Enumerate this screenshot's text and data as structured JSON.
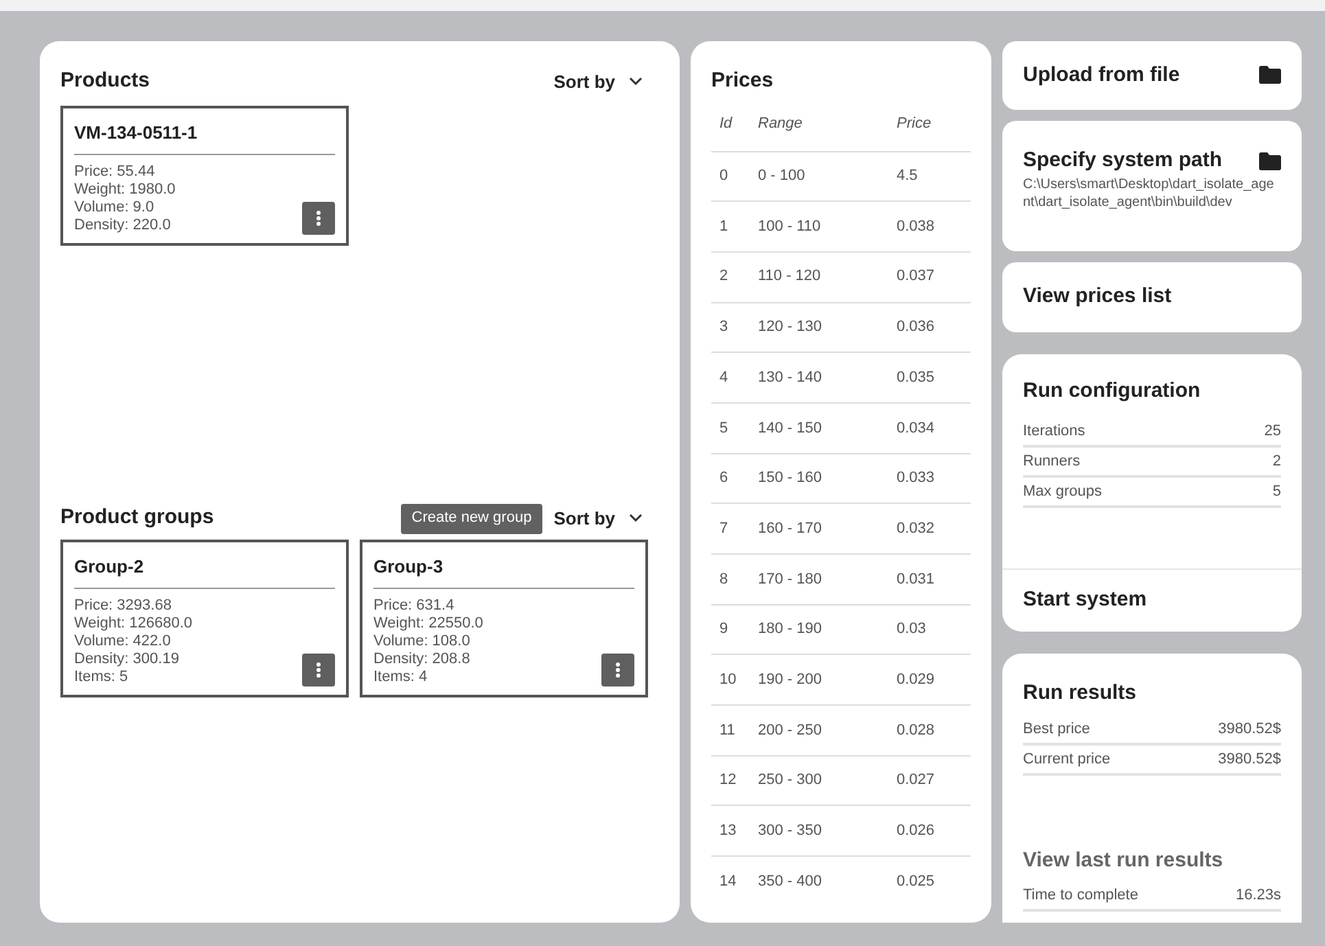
{
  "products": {
    "title": "Products",
    "sort_label": "Sort by",
    "items": [
      {
        "name": "VM-134-0511-1",
        "lines": [
          "Price: 55.44",
          "Weight: 1980.0",
          "Volume: 9.0",
          "Density: 220.0"
        ]
      }
    ]
  },
  "product_groups": {
    "title": "Product groups",
    "create_button": "Create new group",
    "sort_label": "Sort by",
    "items": [
      {
        "name": "Group-2",
        "lines": [
          "Price: 3293.68",
          "Weight: 126680.0",
          "Volume: 422.0",
          "Density: 300.19",
          "Items: 5"
        ]
      },
      {
        "name": "Group-3",
        "lines": [
          "Price: 631.4",
          "Weight: 22550.0",
          "Volume: 108.0",
          "Density: 208.8",
          "Items: 4"
        ]
      }
    ]
  },
  "prices": {
    "title": "Prices",
    "columns": [
      "Id",
      "Range",
      "Price"
    ],
    "rows": [
      [
        "0",
        "0 - 100",
        "4.5"
      ],
      [
        "1",
        "100 - 110",
        "0.038"
      ],
      [
        "2",
        "110 - 120",
        "0.037"
      ],
      [
        "3",
        "120 - 130",
        "0.036"
      ],
      [
        "4",
        "130 - 140",
        "0.035"
      ],
      [
        "5",
        "140 - 150",
        "0.034"
      ],
      [
        "6",
        "150 - 160",
        "0.033"
      ],
      [
        "7",
        "160 - 170",
        "0.032"
      ],
      [
        "8",
        "170 - 180",
        "0.031"
      ],
      [
        "9",
        "180 - 190",
        "0.03"
      ],
      [
        "10",
        "190 - 200",
        "0.029"
      ],
      [
        "11",
        "200 - 250",
        "0.028"
      ],
      [
        "12",
        "250 - 300",
        "0.027"
      ],
      [
        "13",
        "300 - 350",
        "0.026"
      ],
      [
        "14",
        "350 - 400",
        "0.025"
      ]
    ]
  },
  "upload": {
    "label": "Upload from file"
  },
  "system_path": {
    "label": "Specify system path",
    "path": "C:\\Users\\smart\\Desktop\\dart_isolate_agent\\dart_isolate_agent\\bin\\build\\dev"
  },
  "view_prices": {
    "label": "View prices list"
  },
  "run_configuration": {
    "title": "Run configuration",
    "rows": [
      {
        "label": "Iterations",
        "value": "25"
      },
      {
        "label": "Runners",
        "value": "2"
      },
      {
        "label": "Max groups",
        "value": "5"
      }
    ],
    "start_button": "Start system"
  },
  "run_results": {
    "title": "Run results",
    "rows": [
      {
        "label": "Best price",
        "value": "3980.52$"
      },
      {
        "label": "Current price",
        "value": "3980.52$"
      }
    ],
    "last_run": {
      "title": "View last run results",
      "disabled": true,
      "rows": [
        {
          "label": "Time to complete",
          "value": "16.23s"
        }
      ]
    }
  }
}
